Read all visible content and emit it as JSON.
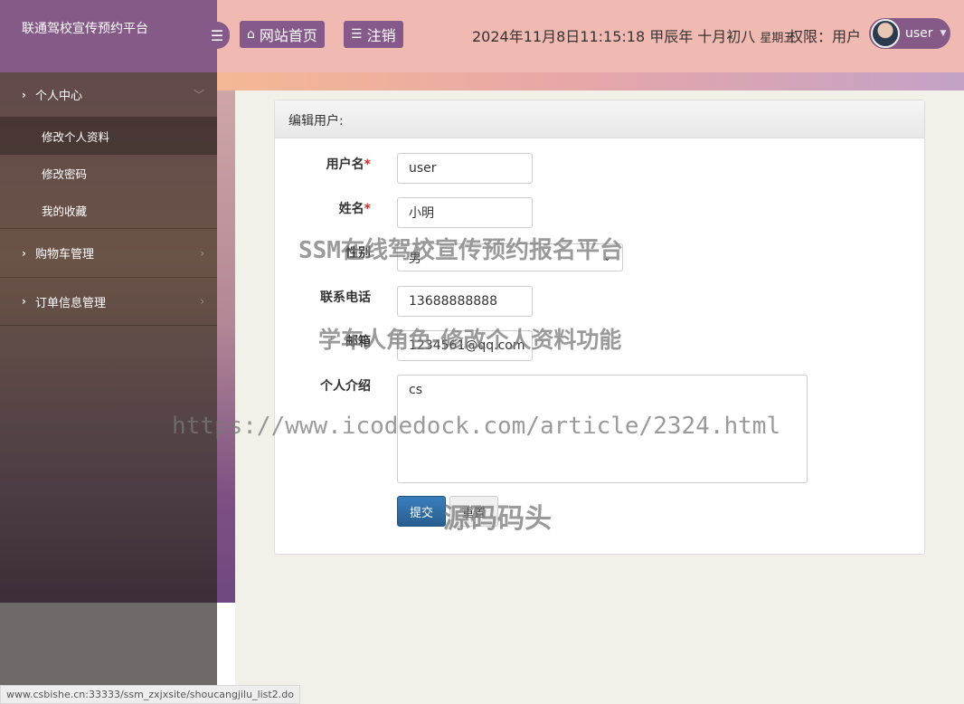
{
  "brand": {
    "title": "联通驾校宣传预约平台"
  },
  "header": {
    "menu_toggle_icon": "hamburger-icon",
    "home_label": "网站首页",
    "logout_label": "注销",
    "datetime": "2024年11月8日11:15:18 甲辰年 十月初八",
    "weekday": "星期五",
    "permission": "权限：用户",
    "username": "user"
  },
  "sidebar": {
    "groups": [
      {
        "label": "个人中心",
        "subitems": [
          "修改个人资料",
          "修改密码",
          "我的收藏"
        ]
      },
      {
        "label": "购物车管理"
      },
      {
        "label": "订单信息管理"
      }
    ]
  },
  "panel": {
    "title": "编辑用户:",
    "fields": {
      "username": {
        "label": "用户名",
        "value": "user"
      },
      "name": {
        "label": "姓名",
        "value": "小明"
      },
      "gender": {
        "label": "性别",
        "value": "男"
      },
      "phone": {
        "label": "联系电话",
        "value": "13688888888"
      },
      "email": {
        "label": "邮箱",
        "value": "1234561@qq.com"
      },
      "intro": {
        "label": "个人介绍",
        "value": "cs"
      }
    },
    "required_mark": "*",
    "submit_label": "提交",
    "reset_label": "重置"
  },
  "watermarks": {
    "line1": "SSM在线驾校宣传预约报名平台",
    "line2": "学车人角色-修改个人资料功能",
    "line3": "https://www.icodedock.com/article/2324.html",
    "line4": "源码码头"
  },
  "status_url": "www.csbishe.cn:33333/ssm_zxjxsite/shoucangjilu_list2.do"
}
